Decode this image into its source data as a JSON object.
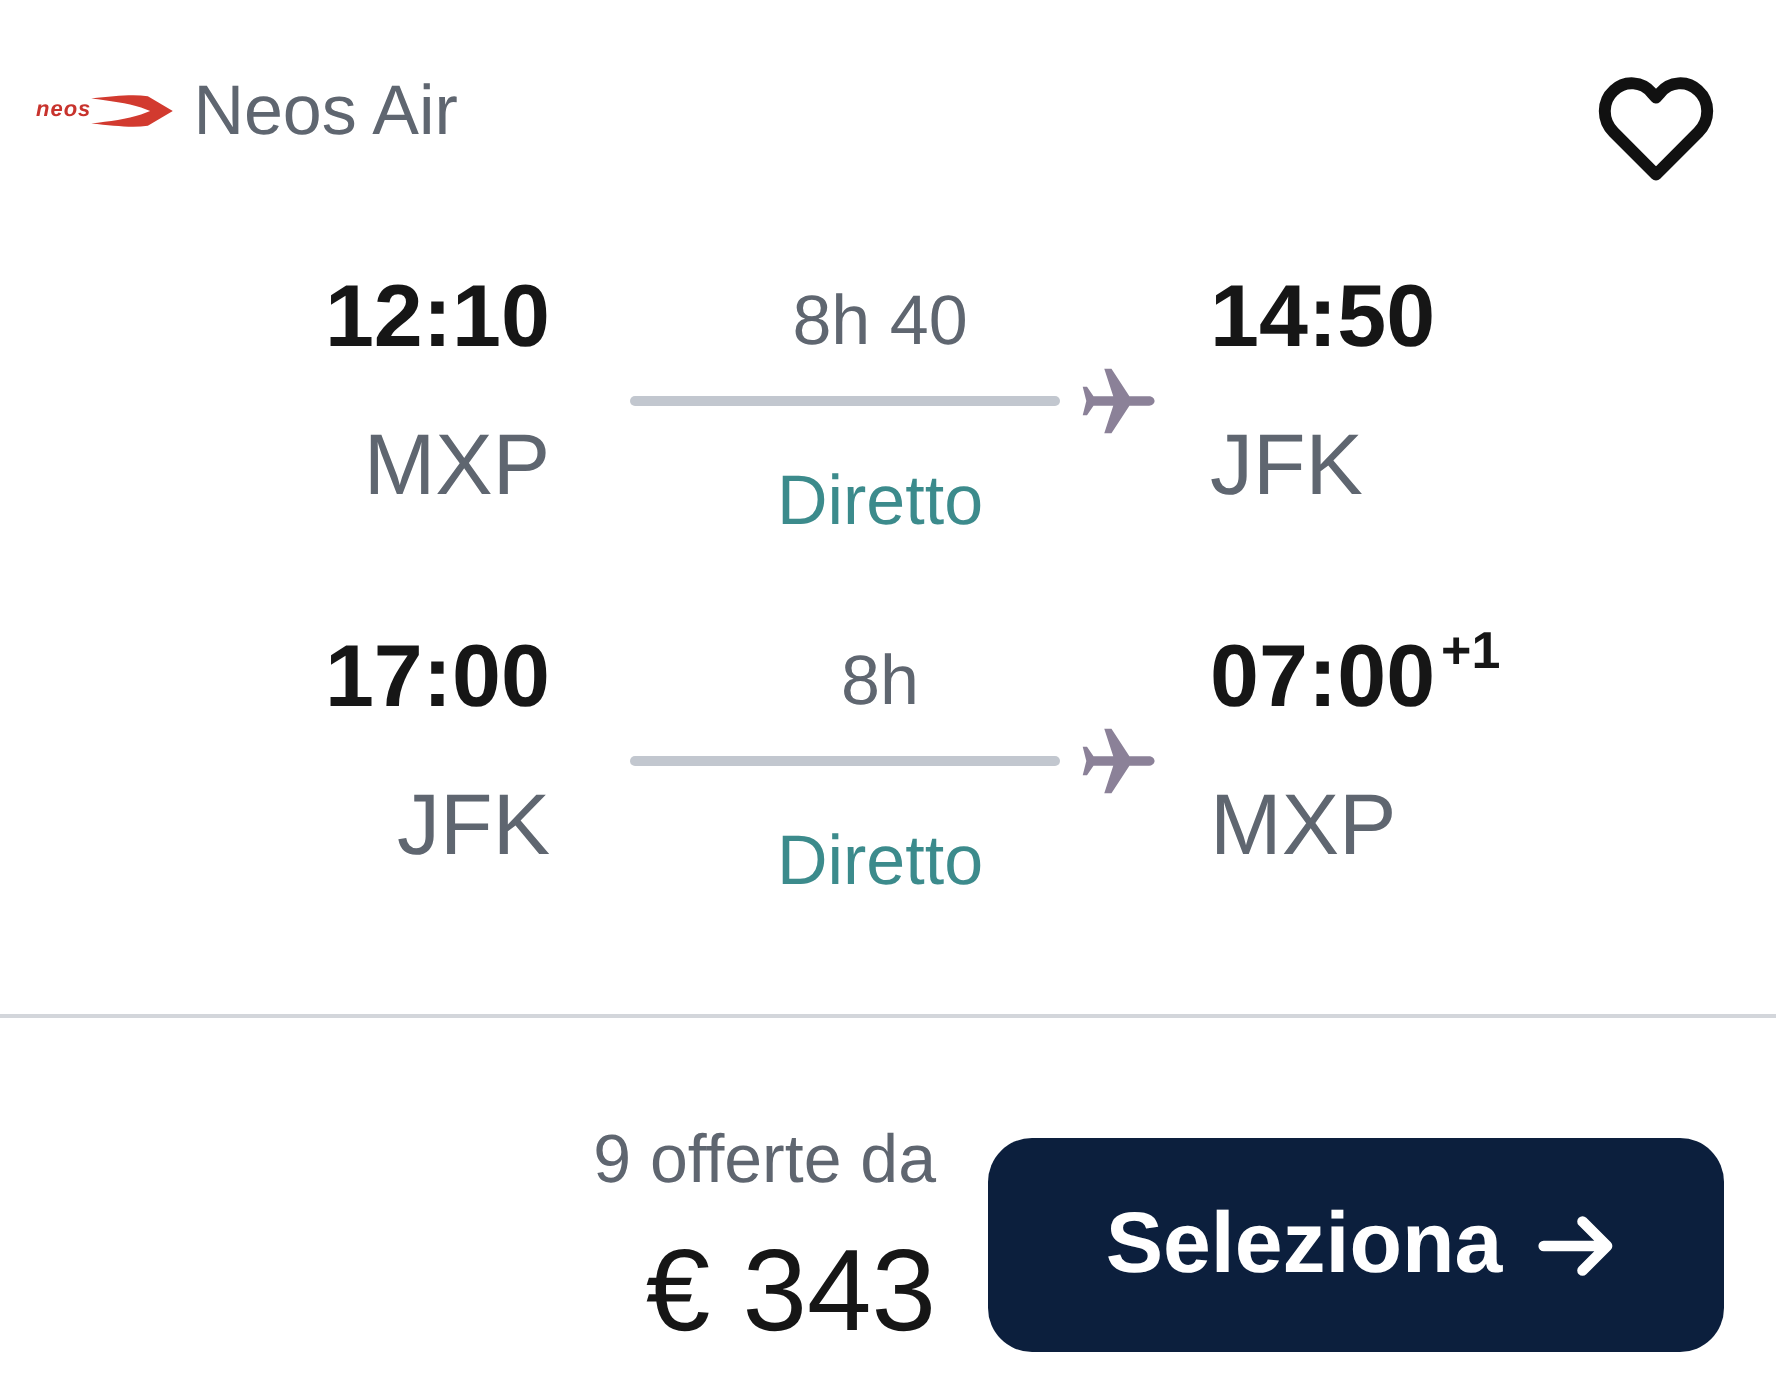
{
  "airline": {
    "logo_text": "neos",
    "name": "Neos Air"
  },
  "favorite": {
    "saved": false
  },
  "legs": [
    {
      "departure": {
        "time": "12:10",
        "airport": "MXP"
      },
      "duration": "8h 40",
      "stops": "Diretto",
      "arrival": {
        "time": "14:50",
        "airport": "JFK"
      }
    },
    {
      "departure": {
        "time": "17:00",
        "airport": "JFK"
      },
      "duration": "8h",
      "stops": "Diretto",
      "arrival": {
        "time": "07:00",
        "day_offset": "+1",
        "airport": "MXP"
      }
    }
  ],
  "price": {
    "offers": "9 offerte da",
    "amount": "€ 343"
  },
  "select_button": {
    "label": "Seleziona"
  }
}
